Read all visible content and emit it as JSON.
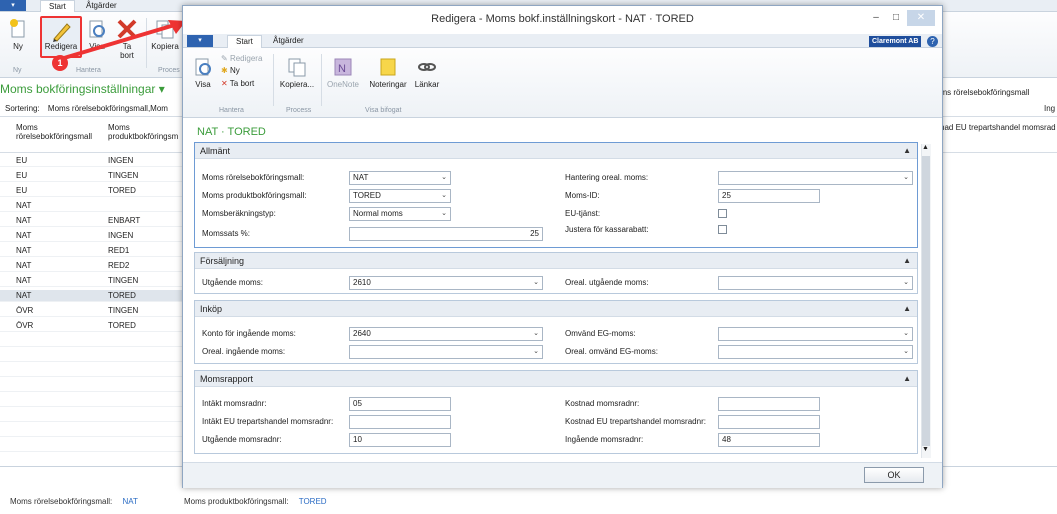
{
  "bg": {
    "app_btn": "▾",
    "tabs": [
      "Start",
      "Åtgärder"
    ],
    "ribbon": {
      "new": "Ny",
      "edit": "Redigera",
      "view": "Visa",
      "delete_l1": "Ta",
      "delete_l2": "bort",
      "copy": "Kopiera",
      "group_new": "Ny",
      "group_manage": "Hantera",
      "group_process": "Proces"
    },
    "title": "Moms bokföringsinställningar",
    "sort_label": "Sortering:",
    "sort_value": "Moms rörelsebokföringsmall,Mom",
    "col1_l1": "Moms",
    "col1_l2": "rörelsebokföringsmall",
    "col2_l1": "Moms",
    "col2_l2": "produktbokföringsm",
    "right_col_header": "oms rörelsebokföringsmall",
    "right_col_header2": "nad EU trepartshandel momsrad",
    "right_ing": "Ing",
    "rows": [
      {
        "a": "EU",
        "b": "INGEN"
      },
      {
        "a": "EU",
        "b": "TINGEN"
      },
      {
        "a": "EU",
        "b": "TORED"
      },
      {
        "a": "NAT",
        "b": ""
      },
      {
        "a": "NAT",
        "b": "ENBART"
      },
      {
        "a": "NAT",
        "b": "INGEN"
      },
      {
        "a": "NAT",
        "b": "RED1"
      },
      {
        "a": "NAT",
        "b": "RED2"
      },
      {
        "a": "NAT",
        "b": "TINGEN"
      },
      {
        "a": "NAT",
        "b": "TORED"
      },
      {
        "a": "ÖVR",
        "b": "TINGEN"
      },
      {
        "a": "ÖVR",
        "b": "TORED"
      }
    ],
    "status_l1": "Moms rörelsebokföringsmall:",
    "status_v1": "NAT",
    "status_l2": "Moms produktbokföringsmall:",
    "status_v2": "TORED",
    "badge": "1"
  },
  "dialog": {
    "title": "Redigera - Moms bokf.inställningskort - NAT · TORED",
    "tabs": [
      "Start",
      "Åtgärder"
    ],
    "company": "Claremont AB",
    "help": "?",
    "ribbon": {
      "view": "Visa",
      "edit": "Redigera",
      "new": "Ny",
      "delete": "Ta bort",
      "copy": "Kopiera...",
      "onenote": "OneNote",
      "notes": "Noteringar",
      "links": "Länkar",
      "grp_manage": "Hantera",
      "grp_process": "Process",
      "grp_attached": "Visa bifogat"
    },
    "card_title": "NAT · TORED",
    "sections": {
      "general": {
        "title": "Allmänt",
        "vat_bus_label": "Moms rörelsebokföringsmall:",
        "vat_bus_value": "NAT",
        "vat_prod_label": "Moms produktbokföringsmall:",
        "vat_prod_value": "TORED",
        "calc_type_label": "Momsberäkningstyp:",
        "calc_type_value": "Normal moms",
        "vat_pct_label": "Momssats %:",
        "vat_pct_value": "25",
        "unreal_label": "Hantering oreal. moms:",
        "unreal_value": "",
        "vat_id_label": "Moms-ID:",
        "vat_id_value": "25",
        "eu_service_label": "EU-tjänst:",
        "adjust_discount_label": "Justera för kassarabatt:"
      },
      "sales": {
        "title": "Försäljning",
        "out_vat_label": "Utgående moms:",
        "out_vat_value": "2610",
        "unreal_out_label": "Oreal. utgående moms:",
        "unreal_out_value": ""
      },
      "purchase": {
        "title": "Inköp",
        "in_acc_label": "Konto för ingående moms:",
        "in_acc_value": "2640",
        "unreal_in_label": "Oreal. ingående moms:",
        "unreal_in_value": "",
        "rev_label": "Omvänd EG-moms:",
        "rev_value": "",
        "unreal_rev_label": "Oreal. omvänd EG-moms:",
        "unreal_rev_value": ""
      },
      "report": {
        "title": "Momsrapport",
        "rev_line_label": "Intäkt momsradnr:",
        "rev_line_value": "05",
        "rev_eu_label": "Intäkt EU trepartshandel momsradnr:",
        "rev_eu_value": "",
        "out_line_label": "Utgående momsradnr:",
        "out_line_value": "10",
        "cost_line_label": "Kostnad momsradnr:",
        "cost_line_value": "",
        "cost_eu_label": "Kostnad EU trepartshandel momsradnr:",
        "cost_eu_value": "",
        "in_line_label": "Ingående momsradnr:",
        "in_line_value": "48"
      }
    },
    "ok": "OK"
  }
}
